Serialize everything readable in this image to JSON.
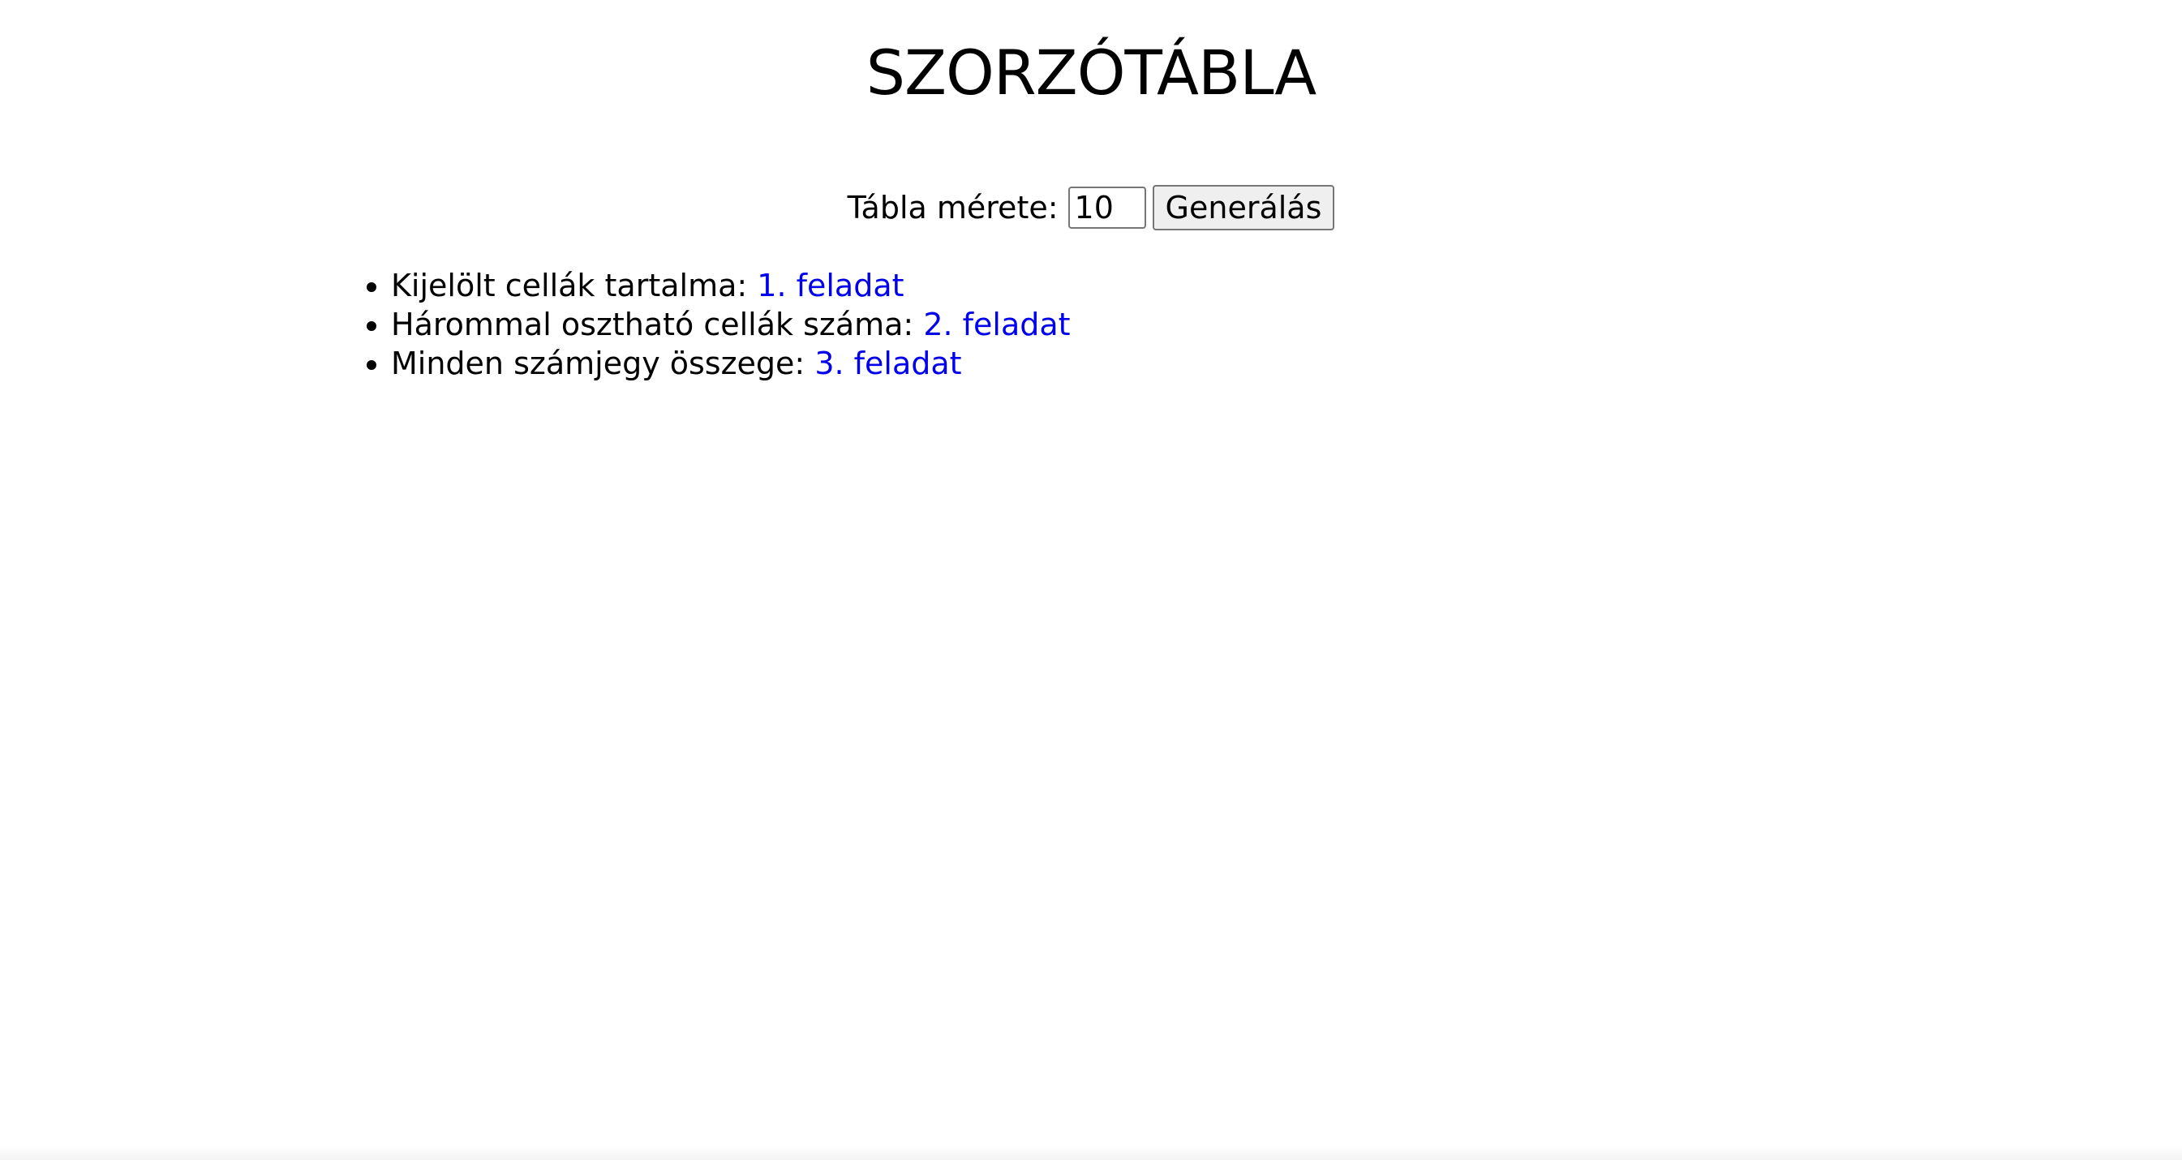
{
  "header": {
    "title": "SZORZÓTÁBLA"
  },
  "controls": {
    "size_label": "Tábla mérete:",
    "size_value": "10",
    "generate_label": "Generálás"
  },
  "tasks": [
    {
      "text": "Kijelölt cellák tartalma:",
      "link": "1. feladat"
    },
    {
      "text": "Hárommal osztható cellák száma:",
      "link": "2. feladat"
    },
    {
      "text": "Minden számjegy összege:",
      "link": "3. feladat"
    }
  ],
  "colors": {
    "link": "#0000ee",
    "button_bg": "#efefef"
  }
}
